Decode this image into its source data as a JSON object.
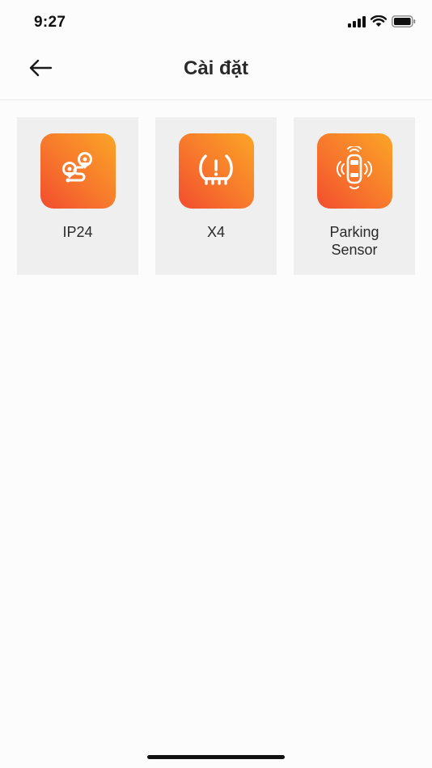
{
  "status_bar": {
    "time": "9:27",
    "icons": [
      "cellular-signal-icon",
      "wifi-icon",
      "battery-icon"
    ]
  },
  "header": {
    "back_icon": "arrow-left-icon",
    "title": "Cài đặt"
  },
  "tiles": [
    {
      "label": "IP24",
      "icon": "route-pins-icon"
    },
    {
      "label": "X4",
      "icon": "tire-pressure-warning-icon"
    },
    {
      "label": "Parking\nSensor",
      "icon": "car-parking-sensor-icon"
    }
  ],
  "colors": {
    "accent_gradient_start": "#fba526",
    "accent_gradient_end": "#f24d2e",
    "tile_background": "#efefef",
    "page_background": "#fcfcfc"
  }
}
